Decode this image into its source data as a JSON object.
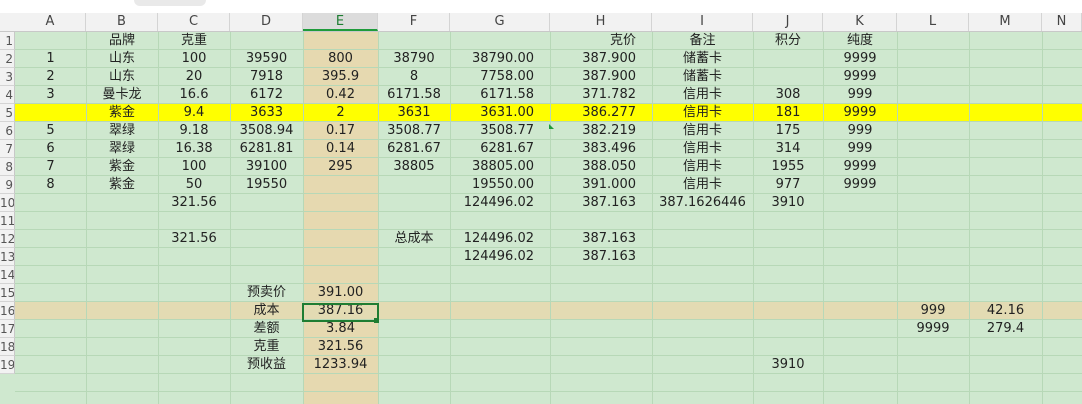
{
  "columns": [
    "A",
    "B",
    "C",
    "D",
    "E",
    "F",
    "G",
    "H",
    "I",
    "J",
    "K",
    "L",
    "M",
    "N"
  ],
  "row_numbers": [
    "1",
    "2",
    "3",
    "4",
    "5",
    "6",
    "7",
    "8",
    "9",
    "10",
    "11",
    "12",
    "13",
    "14",
    "15",
    "16",
    "17",
    "18",
    "19"
  ],
  "cells": [
    {
      "r": 0,
      "c": 1,
      "v": "品牌"
    },
    {
      "r": 0,
      "c": 2,
      "v": "克重"
    },
    {
      "r": 0,
      "c": 7,
      "v": "克价"
    },
    {
      "r": 0,
      "c": 8,
      "v": "备注"
    },
    {
      "r": 0,
      "c": 9,
      "v": "积分"
    },
    {
      "r": 0,
      "c": 10,
      "v": "纯度"
    },
    {
      "r": 1,
      "c": 0,
      "v": "1"
    },
    {
      "r": 1,
      "c": 1,
      "v": "山东"
    },
    {
      "r": 1,
      "c": 2,
      "v": "100"
    },
    {
      "r": 1,
      "c": 3,
      "v": "39590"
    },
    {
      "r": 1,
      "c": 4,
      "v": "800"
    },
    {
      "r": 1,
      "c": 5,
      "v": "38790"
    },
    {
      "r": 1,
      "c": 6,
      "v": "38790.00"
    },
    {
      "r": 1,
      "c": 7,
      "v": "387.900"
    },
    {
      "r": 1,
      "c": 8,
      "v": "储蓄卡"
    },
    {
      "r": 1,
      "c": 10,
      "v": "9999"
    },
    {
      "r": 2,
      "c": 0,
      "v": "2"
    },
    {
      "r": 2,
      "c": 1,
      "v": "山东"
    },
    {
      "r": 2,
      "c": 2,
      "v": "20"
    },
    {
      "r": 2,
      "c": 3,
      "v": "7918"
    },
    {
      "r": 2,
      "c": 4,
      "v": "395.9"
    },
    {
      "r": 2,
      "c": 5,
      "v": "8"
    },
    {
      "r": 2,
      "c": 6,
      "v": "7758.00"
    },
    {
      "r": 2,
      "c": 7,
      "v": "387.900"
    },
    {
      "r": 2,
      "c": 8,
      "v": "储蓄卡"
    },
    {
      "r": 2,
      "c": 10,
      "v": "9999"
    },
    {
      "r": 3,
      "c": 0,
      "v": "3"
    },
    {
      "r": 3,
      "c": 1,
      "v": "曼卡龙"
    },
    {
      "r": 3,
      "c": 2,
      "v": "16.6"
    },
    {
      "r": 3,
      "c": 3,
      "v": "6172"
    },
    {
      "r": 3,
      "c": 4,
      "v": "0.42"
    },
    {
      "r": 3,
      "c": 5,
      "v": "6171.58"
    },
    {
      "r": 3,
      "c": 6,
      "v": "6171.58"
    },
    {
      "r": 3,
      "c": 7,
      "v": "371.782"
    },
    {
      "r": 3,
      "c": 8,
      "v": "信用卡"
    },
    {
      "r": 3,
      "c": 9,
      "v": "308"
    },
    {
      "r": 3,
      "c": 10,
      "v": "999"
    },
    {
      "r": 4,
      "c": 1,
      "v": "紫金"
    },
    {
      "r": 4,
      "c": 2,
      "v": "9.4"
    },
    {
      "r": 4,
      "c": 3,
      "v": "3633"
    },
    {
      "r": 4,
      "c": 4,
      "v": "2"
    },
    {
      "r": 4,
      "c": 5,
      "v": "3631"
    },
    {
      "r": 4,
      "c": 6,
      "v": "3631.00"
    },
    {
      "r": 4,
      "c": 7,
      "v": "386.277"
    },
    {
      "r": 4,
      "c": 8,
      "v": "信用卡"
    },
    {
      "r": 4,
      "c": 9,
      "v": "181"
    },
    {
      "r": 4,
      "c": 10,
      "v": "9999"
    },
    {
      "r": 5,
      "c": 0,
      "v": "5"
    },
    {
      "r": 5,
      "c": 1,
      "v": "翠绿"
    },
    {
      "r": 5,
      "c": 2,
      "v": "9.18"
    },
    {
      "r": 5,
      "c": 3,
      "v": "3508.94"
    },
    {
      "r": 5,
      "c": 4,
      "v": "0.17"
    },
    {
      "r": 5,
      "c": 5,
      "v": "3508.77"
    },
    {
      "r": 5,
      "c": 6,
      "v": "3508.77"
    },
    {
      "r": 5,
      "c": 7,
      "v": "382.219"
    },
    {
      "r": 5,
      "c": 8,
      "v": "信用卡"
    },
    {
      "r": 5,
      "c": 9,
      "v": "175"
    },
    {
      "r": 5,
      "c": 10,
      "v": "999"
    },
    {
      "r": 6,
      "c": 0,
      "v": "6"
    },
    {
      "r": 6,
      "c": 1,
      "v": "翠绿"
    },
    {
      "r": 6,
      "c": 2,
      "v": "16.38"
    },
    {
      "r": 6,
      "c": 3,
      "v": "6281.81"
    },
    {
      "r": 6,
      "c": 4,
      "v": "0.14"
    },
    {
      "r": 6,
      "c": 5,
      "v": "6281.67"
    },
    {
      "r": 6,
      "c": 6,
      "v": "6281.67"
    },
    {
      "r": 6,
      "c": 7,
      "v": "383.496"
    },
    {
      "r": 6,
      "c": 8,
      "v": "信用卡"
    },
    {
      "r": 6,
      "c": 9,
      "v": "314"
    },
    {
      "r": 6,
      "c": 10,
      "v": "999"
    },
    {
      "r": 7,
      "c": 0,
      "v": "7"
    },
    {
      "r": 7,
      "c": 1,
      "v": "紫金"
    },
    {
      "r": 7,
      "c": 2,
      "v": "100"
    },
    {
      "r": 7,
      "c": 3,
      "v": "39100"
    },
    {
      "r": 7,
      "c": 4,
      "v": "295"
    },
    {
      "r": 7,
      "c": 5,
      "v": "38805"
    },
    {
      "r": 7,
      "c": 6,
      "v": "38805.00"
    },
    {
      "r": 7,
      "c": 7,
      "v": "388.050"
    },
    {
      "r": 7,
      "c": 8,
      "v": "信用卡"
    },
    {
      "r": 7,
      "c": 9,
      "v": "1955"
    },
    {
      "r": 7,
      "c": 10,
      "v": "9999"
    },
    {
      "r": 8,
      "c": 0,
      "v": "8"
    },
    {
      "r": 8,
      "c": 1,
      "v": "紫金"
    },
    {
      "r": 8,
      "c": 2,
      "v": "50"
    },
    {
      "r": 8,
      "c": 3,
      "v": "19550"
    },
    {
      "r": 8,
      "c": 6,
      "v": "19550.00"
    },
    {
      "r": 8,
      "c": 7,
      "v": "391.000"
    },
    {
      "r": 8,
      "c": 8,
      "v": "信用卡"
    },
    {
      "r": 8,
      "c": 9,
      "v": "977"
    },
    {
      "r": 8,
      "c": 10,
      "v": "9999"
    },
    {
      "r": 9,
      "c": 2,
      "v": "321.56"
    },
    {
      "r": 9,
      "c": 6,
      "v": "124496.02"
    },
    {
      "r": 9,
      "c": 7,
      "v": "387.163"
    },
    {
      "r": 9,
      "c": 8,
      "v": "387.1626446"
    },
    {
      "r": 9,
      "c": 9,
      "v": "3910"
    },
    {
      "r": 11,
      "c": 2,
      "v": "321.56"
    },
    {
      "r": 11,
      "c": 5,
      "v": "总成本"
    },
    {
      "r": 11,
      "c": 6,
      "v": "124496.02"
    },
    {
      "r": 11,
      "c": 7,
      "v": "387.163"
    },
    {
      "r": 12,
      "c": 6,
      "v": "124496.02"
    },
    {
      "r": 12,
      "c": 7,
      "v": "387.163"
    },
    {
      "r": 14,
      "c": 3,
      "v": "预卖价"
    },
    {
      "r": 14,
      "c": 4,
      "v": "391.00"
    },
    {
      "r": 15,
      "c": 3,
      "v": "成本"
    },
    {
      "r": 15,
      "c": 4,
      "v": "387.16"
    },
    {
      "r": 15,
      "c": 11,
      "v": "999"
    },
    {
      "r": 15,
      "c": 12,
      "v": "42.16"
    },
    {
      "r": 16,
      "c": 3,
      "v": "差额"
    },
    {
      "r": 16,
      "c": 4,
      "v": "3.84"
    },
    {
      "r": 16,
      "c": 11,
      "v": "9999"
    },
    {
      "r": 16,
      "c": 12,
      "v": "279.4"
    },
    {
      "r": 17,
      "c": 3,
      "v": "克重"
    },
    {
      "r": 17,
      "c": 4,
      "v": "321.56"
    },
    {
      "r": 18,
      "c": 3,
      "v": "预收益"
    },
    {
      "r": 18,
      "c": 4,
      "v": "1233.94"
    },
    {
      "r": 18,
      "c": 9,
      "v": "3910"
    }
  ],
  "highlight_row": 4,
  "tan_row": 15,
  "selected_column": "E",
  "active_cell": "E16",
  "colors": {
    "grid_bg": "#cfe8cf",
    "highlight": "#ffff00",
    "selected_col": "#e6d9b0",
    "accent": "#1e7d32"
  }
}
